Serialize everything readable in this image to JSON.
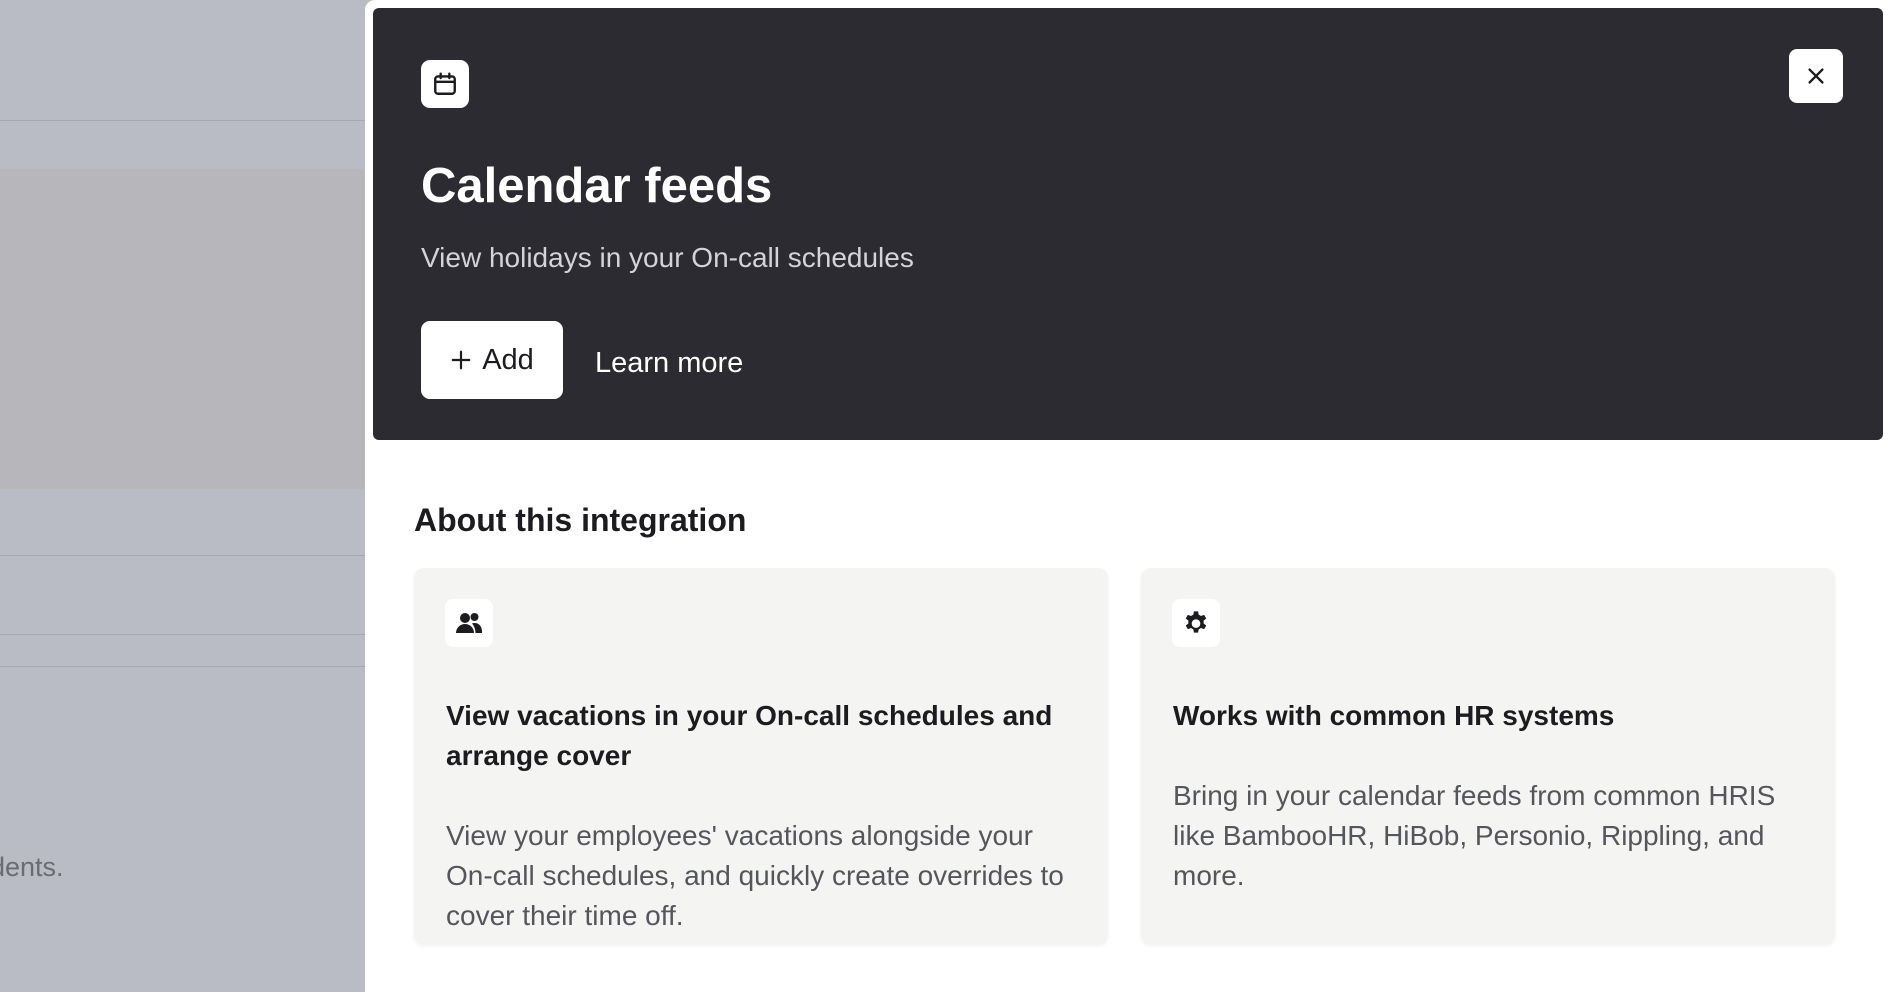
{
  "background": {
    "partial_text": "dents."
  },
  "drawer": {
    "header": {
      "icon": "calendar-icon",
      "title": "Calendar feeds",
      "subtitle": "View holidays in your On-call schedules",
      "add_button_label": "Add",
      "learn_more_label": "Learn more",
      "close_icon": "close-icon",
      "background_color": "#2b2b31"
    },
    "about": {
      "title": "About this integration",
      "cards": [
        {
          "icon": "users-icon",
          "title": "View vacations in your On-call schedules and arrange cover",
          "body": "View your employees' vacations alongside your On-call schedules, and quickly create overrides to cover their time off."
        },
        {
          "icon": "gear-icon",
          "title": "Works with common HR systems",
          "body": "Bring in your calendar feeds from common HRIS like BambooHR, HiBob, Personio, Rippling, and more."
        }
      ]
    }
  }
}
